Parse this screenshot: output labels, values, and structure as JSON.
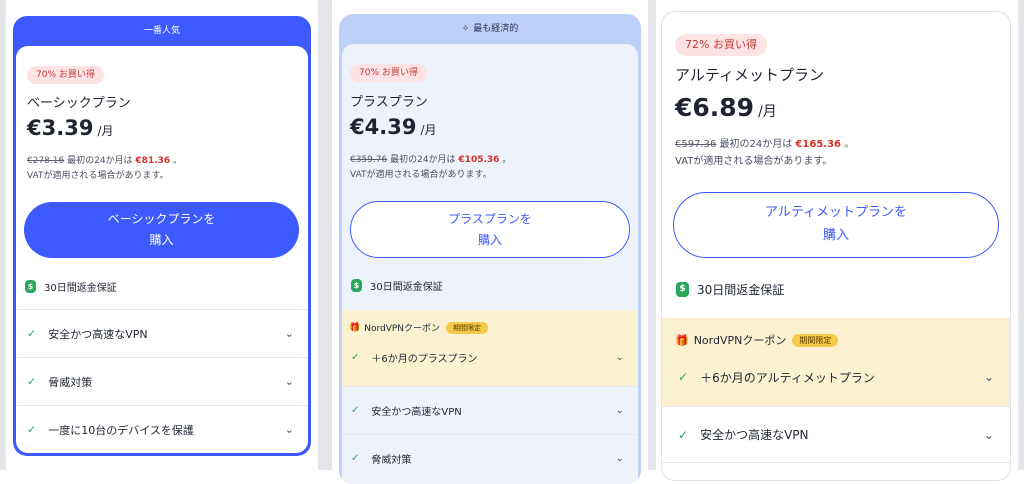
{
  "cards": [
    {
      "banner": "一番人気",
      "badge": "70% お買い得",
      "plan_name": "ベーシックプラン",
      "price": "€3.39",
      "per": "/月",
      "original": "€278.16",
      "first_term": "最初の24か月は",
      "sale": "€81.36",
      "sale_suffix": "。",
      "vat": "VATが適用される場合があります。",
      "button_line1": "ベーシックプランを",
      "button_line2": "購入",
      "guarantee_icon": "$",
      "guarantee": "30日間返金保証",
      "features": [
        "安全かつ高速なVPN",
        "脅威対策",
        "一度に10台のデバイスを保護"
      ]
    },
    {
      "banner": "最も経済的",
      "banner_icon": "✧",
      "badge": "70% お買い得",
      "plan_name": "プラスプラン",
      "price": "€4.39",
      "per": "/月",
      "original": "€359.76",
      "first_term": "最初の24か月は",
      "sale": "€105.36",
      "sale_suffix": "。",
      "vat": "VATが適用される場合があります。",
      "button_line1": "プラスプランを",
      "button_line2": "購入",
      "guarantee_icon": "$",
      "guarantee": "30日間返金保証",
      "coupon_title": "NordVPNクーポン",
      "coupon_badge": "期間限定",
      "coupon_feature": "＋6か月のプラスプラン",
      "features": [
        "安全かつ高速なVPN",
        "脅威対策"
      ]
    },
    {
      "badge": "72% お買い得",
      "plan_name": "アルティメットプラン",
      "price": "€6.89",
      "per": "/月",
      "original": "€597.36",
      "first_term": "最初の24か月は",
      "sale": "€165.36",
      "sale_suffix": "。",
      "vat": "VATが適用される場合があります。",
      "button_line1": "アルティメットプランを",
      "button_line2": "購入",
      "guarantee_icon": "$",
      "guarantee": "30日間返金保証",
      "coupon_title": "NordVPNクーポン",
      "coupon_badge": "期間限定",
      "coupon_feature": "＋6か月のアルティメットプラン",
      "features": [
        "安全かつ高速なVPN"
      ]
    }
  ],
  "icons": {
    "check": "✓",
    "chevron": "⌄",
    "gift": "🎁"
  },
  "colors": {
    "accent": "#3d5afe",
    "sale": "#d93025",
    "check": "#27a85a",
    "coupon_bg": "#fcf2d2",
    "badge_bg": "#fde3e3"
  }
}
